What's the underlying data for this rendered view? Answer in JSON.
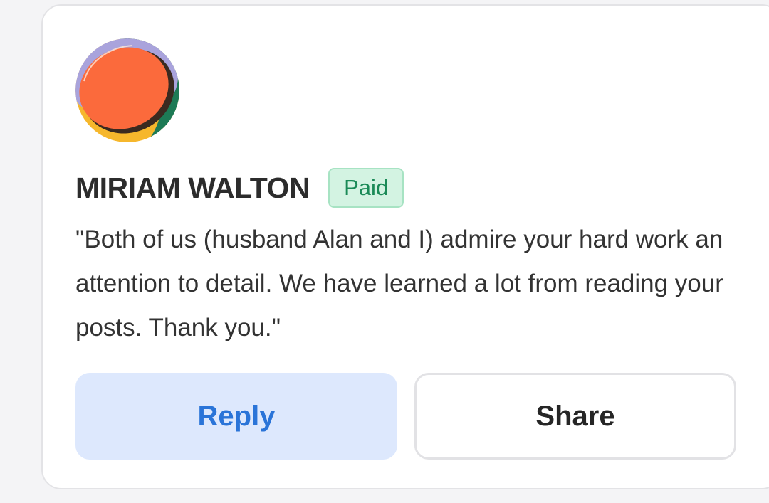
{
  "comment_card": {
    "author": {
      "name": "MIRIAM WALTON",
      "badge": "Paid",
      "avatar_icon": "abstract-circle-avatar"
    },
    "body": "\"Both of us (husband Alan and I) admire your hard work an attention to detail. We have learned a lot from reading your posts. Thank you.\"",
    "actions": {
      "reply_label": "Reply",
      "share_label": "Share"
    }
  },
  "colors": {
    "badge_background": "#d3f3e2",
    "badge_text": "#1a8a57",
    "reply_background": "#dde8fd",
    "reply_text": "#2a74d8",
    "share_text": "#262626",
    "avatar_orange": "#fb6a3c",
    "avatar_yellow": "#f6b72c",
    "avatar_green": "#1d7a55",
    "avatar_lavender": "#a9a3dc"
  }
}
